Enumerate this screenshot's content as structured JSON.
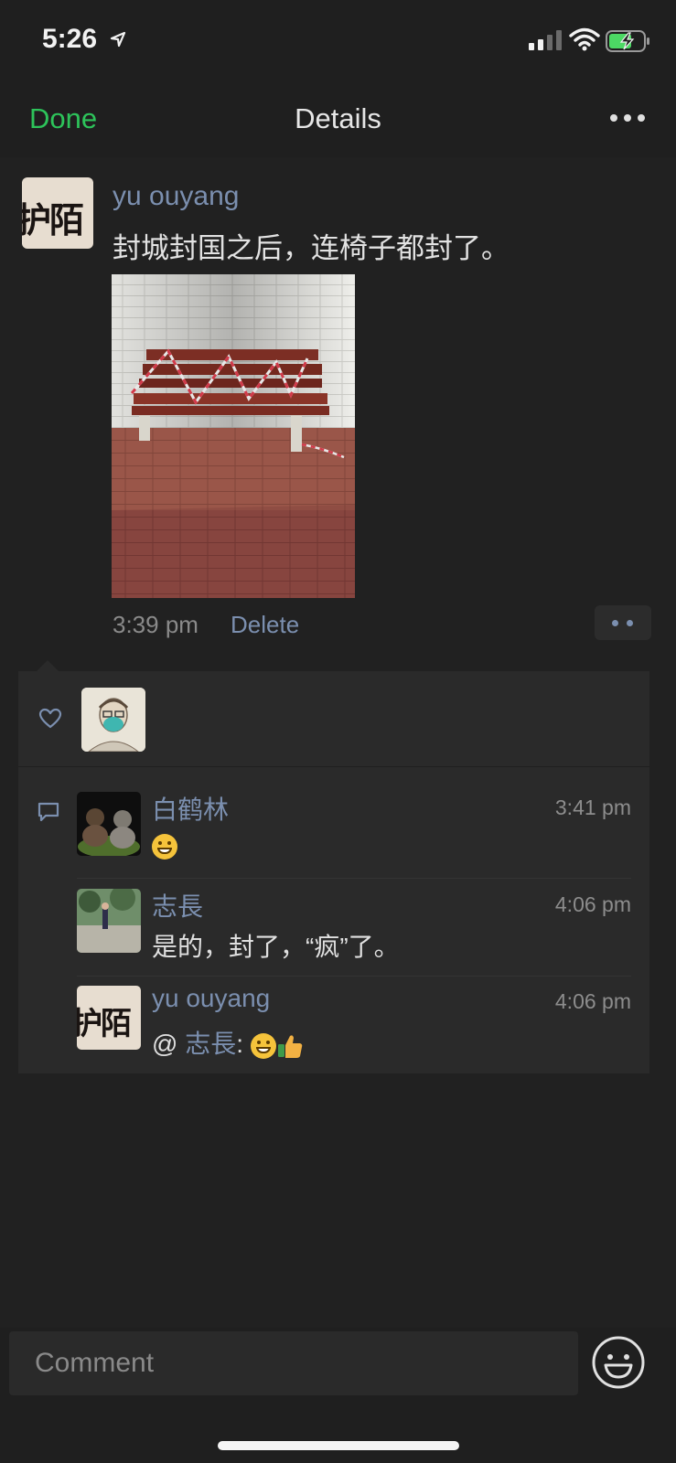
{
  "status_bar": {
    "time": "5:26"
  },
  "nav": {
    "done_label": "Done",
    "title": "Details",
    "more_icon": "more-dots-icon"
  },
  "post": {
    "author": "yu ouyang",
    "avatar_text": "护陌",
    "text": "封城封国之后，连椅子都封了。",
    "time": "3:39 pm",
    "delete_label": "Delete"
  },
  "likes": {
    "icon": "heart-icon"
  },
  "comments": [
    {
      "name": "白鹤林",
      "time": "3:41 pm",
      "text": ""
    },
    {
      "name": "志長",
      "time": "4:06 pm",
      "text": "是的，封了，“疯”了。"
    },
    {
      "name": "yu ouyang",
      "time": "4:06 pm",
      "avatar_text": "护陌",
      "prefix": "@ ",
      "mention": "志長",
      "suffix": ": "
    }
  ],
  "comment_input": {
    "placeholder": "Comment"
  },
  "colors": {
    "accent": "#2dc35a",
    "link": "#7b8faf",
    "background": "#1f1f1f",
    "panel": "#2a2a2a"
  }
}
